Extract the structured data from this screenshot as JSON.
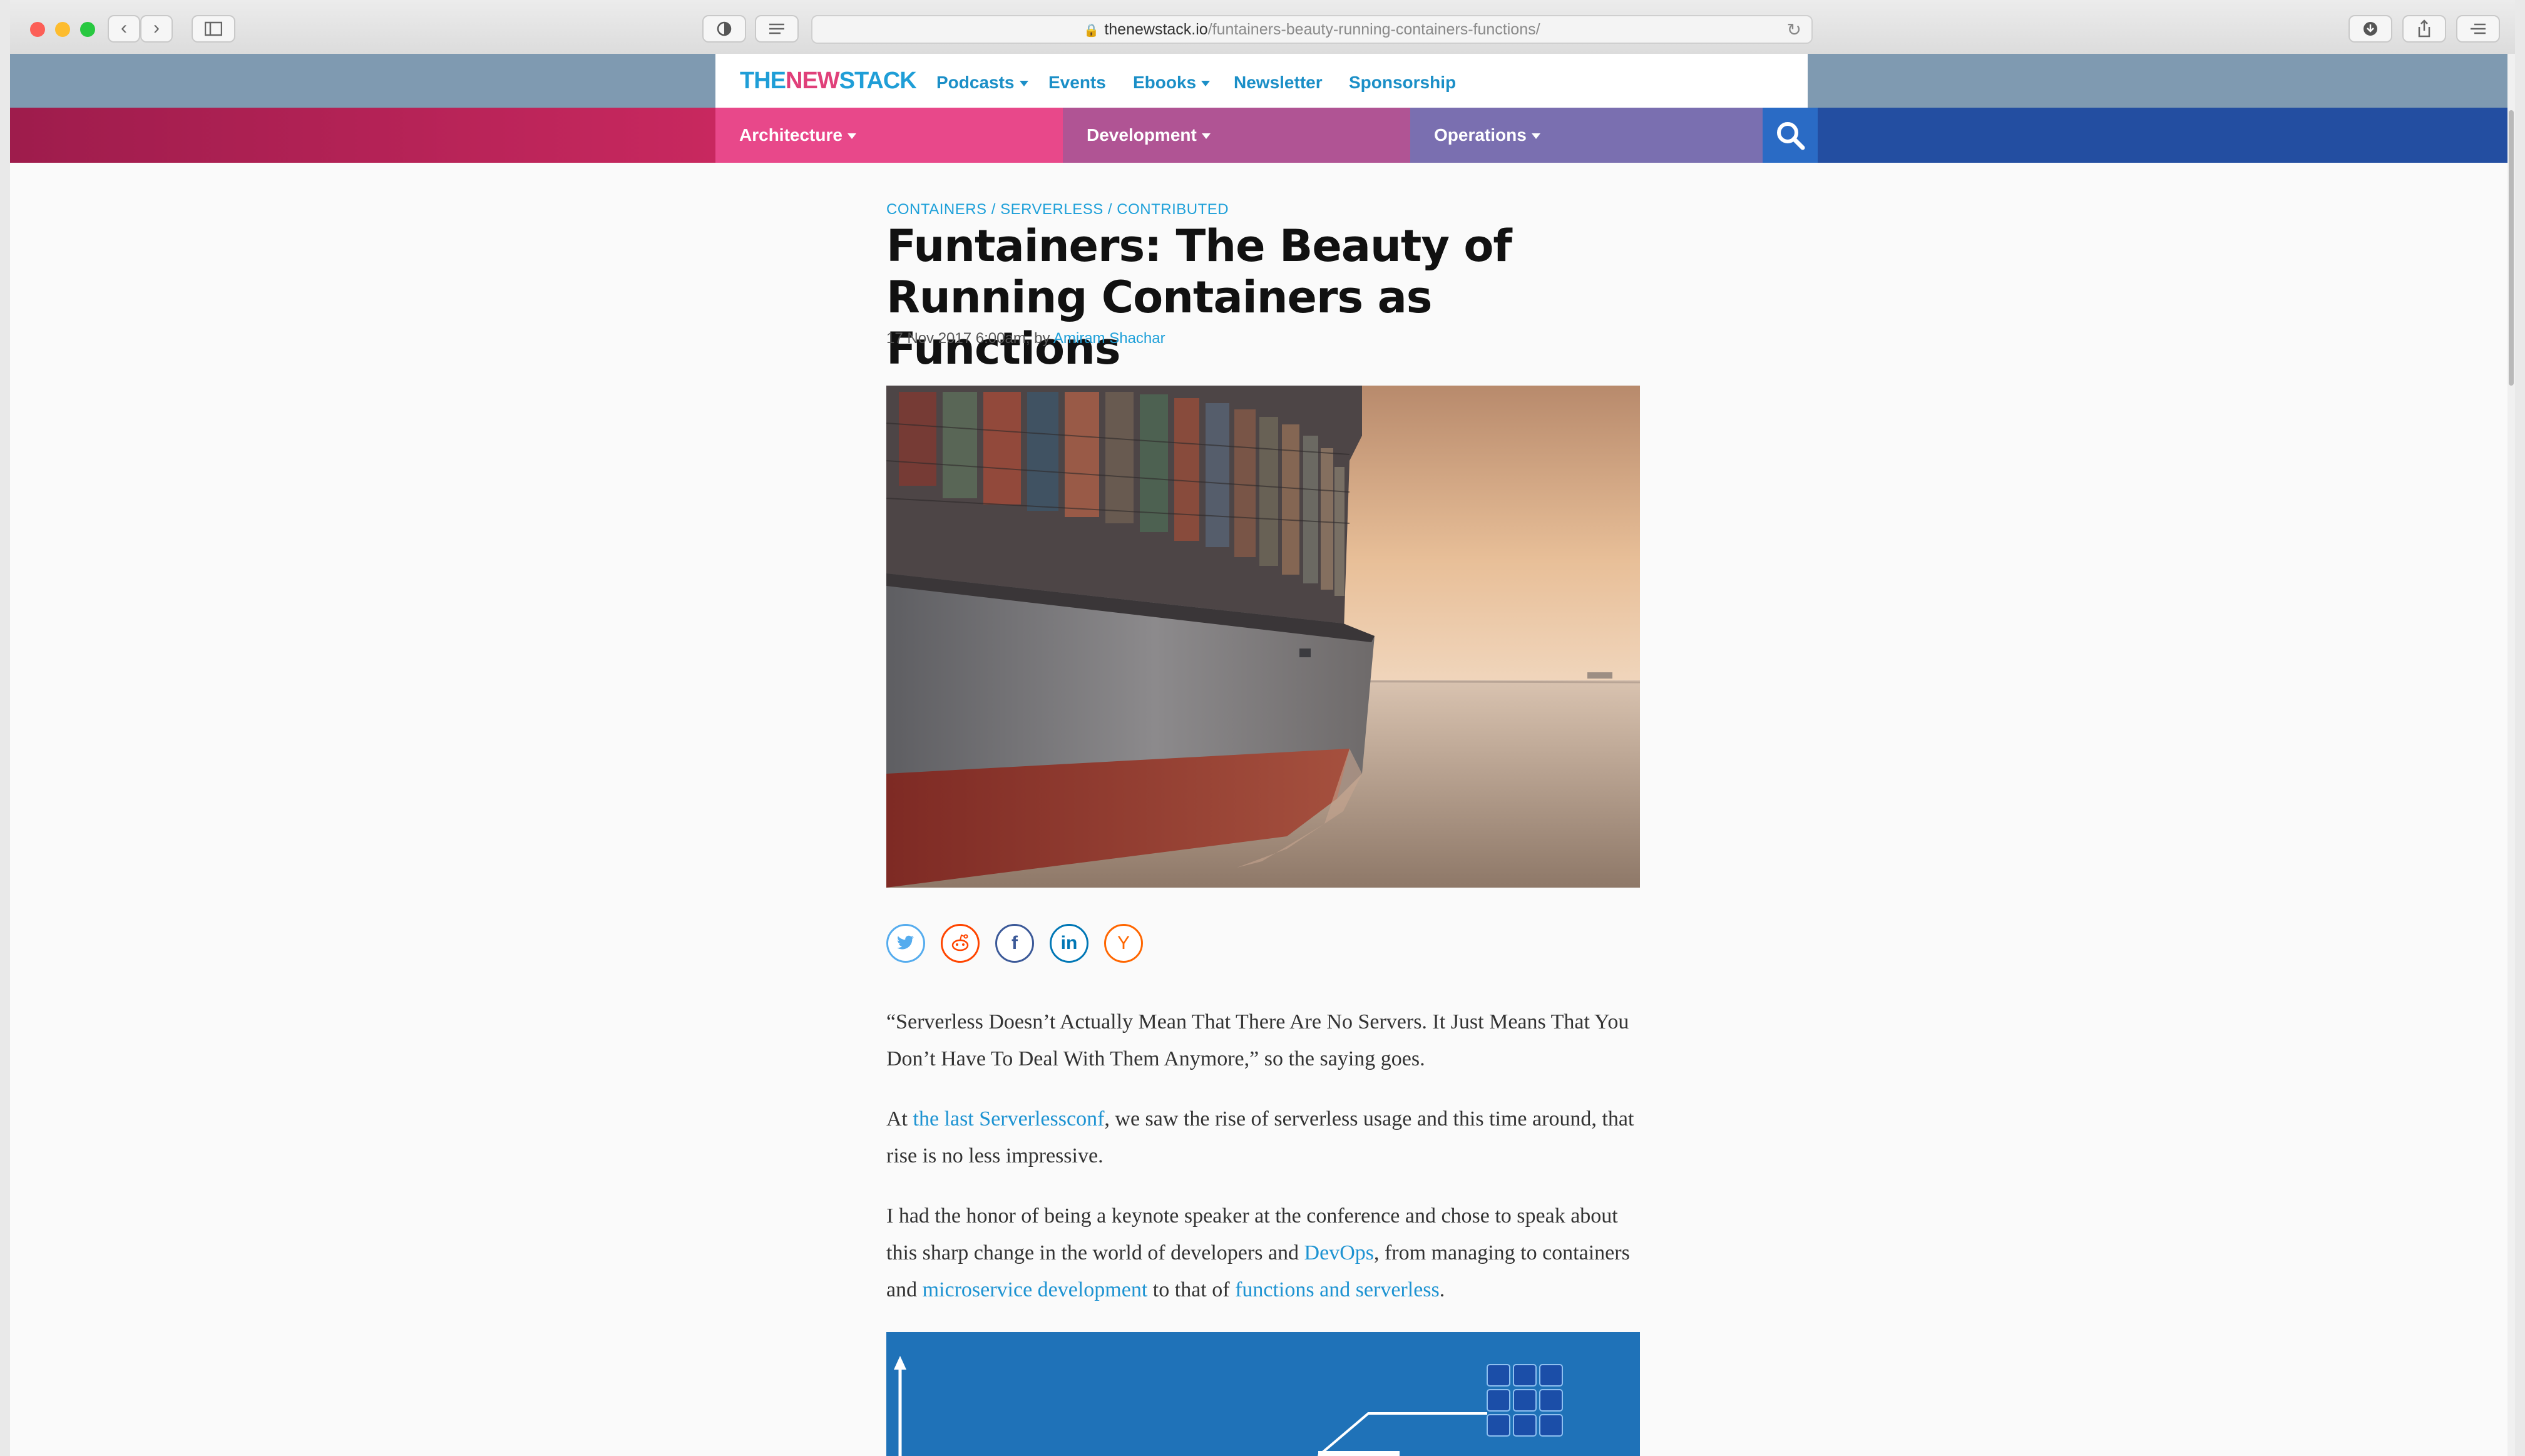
{
  "browser": {
    "url_host": "thenewstack.io",
    "url_path": "/funtainers-beauty-running-containers-functions/"
  },
  "site": {
    "logo_part1": "THE",
    "logo_part2": "NEW",
    "logo_part3": "STACK",
    "nav": {
      "podcasts": "Podcasts",
      "events": "Events",
      "ebooks": "Ebooks",
      "newsletter": "Newsletter",
      "sponsorship": "Sponsorship"
    },
    "categories": {
      "architecture": "Architecture",
      "development": "Development",
      "operations": "Operations"
    }
  },
  "article": {
    "crumb1": "CONTAINERS",
    "crumb2": "SERVERLESS",
    "crumb3": "CONTRIBUTED",
    "crumb_sep": " / ",
    "title": "Funtainers: The Beauty of Running Containers as Functions",
    "date": "17 Nov 2017 6:00am,",
    "by": "by",
    "author": "Amiram Shachar",
    "p1": "“Serverless Doesn’t Actually Mean That There Are No Servers. It Just Means That You Don’t Have To Deal With Them Anymore,” so the saying goes.",
    "p2_a": "At ",
    "p2_link": "the last Serverlessconf",
    "p2_b": ", we saw the rise of serverless usage and this time around, that rise is no less impressive.",
    "p3_a": "I had the honor of being a keynote speaker at the conference and chose to speak about this sharp change in the world of developers and ",
    "p3_link1": "DevOps",
    "p3_b": ", from managing to containers and ",
    "p3_link2": "microservice development",
    "p3_c": " to that of ",
    "p3_link3": "functions and serverless",
    "p3_d": "."
  },
  "share": {
    "twitter": "twitter-icon",
    "reddit": "reddit-icon",
    "facebook": "f",
    "linkedin": "in",
    "hackernews": "Y"
  },
  "colors": {
    "accent_blue": "#1ea0d9",
    "architecture_band": "#e8488a",
    "development_band": "#b05494",
    "operations_band": "#7a6fb0",
    "search_bg": "#2a6bc5"
  }
}
